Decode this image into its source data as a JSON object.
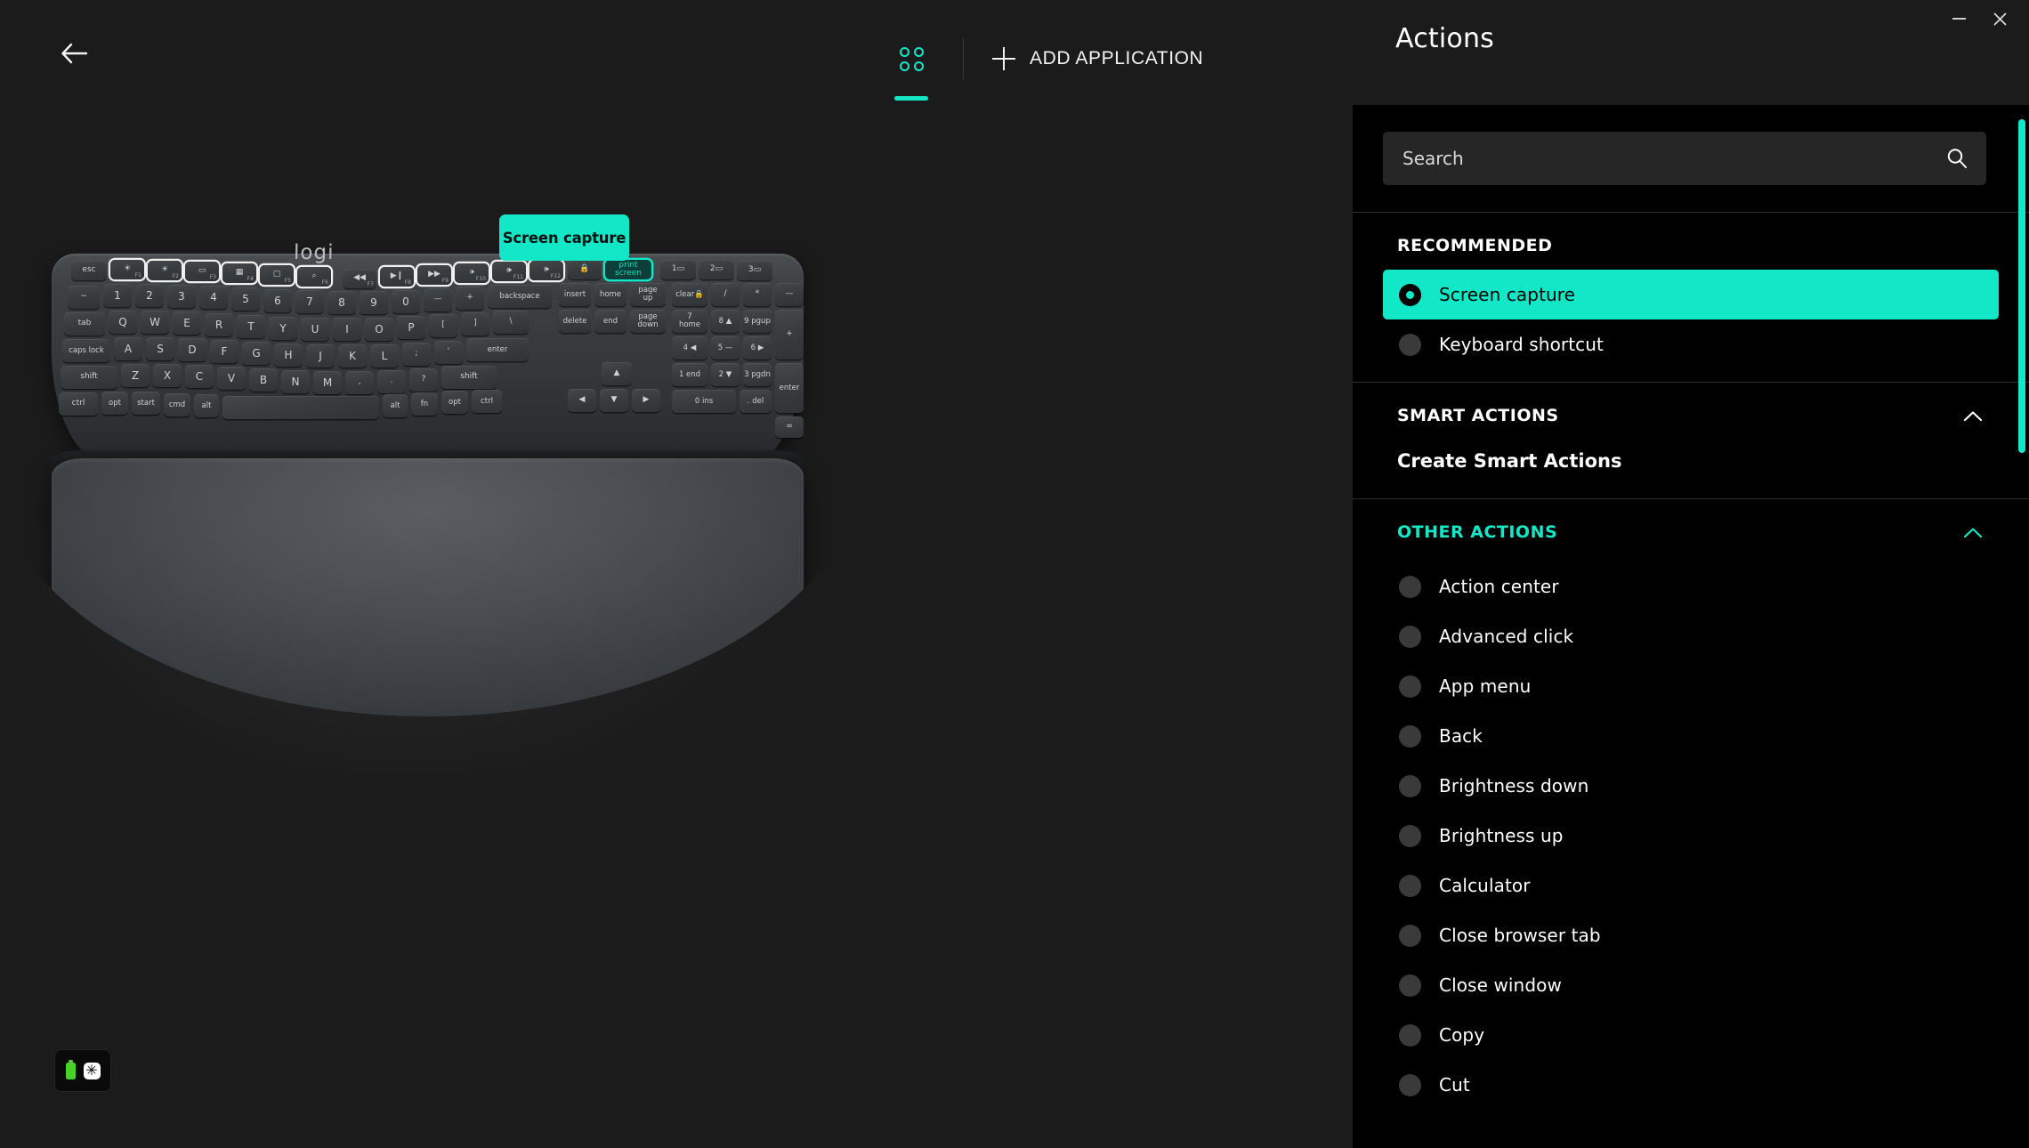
{
  "window": {
    "minimize_label": "—",
    "close_label": "×"
  },
  "toolbar": {
    "back_label": "Back",
    "grid_tab_label": "Applications grid",
    "add_application_label": "ADD APPLICATION"
  },
  "device": {
    "brand": "logi",
    "tooltip_label": "Screen capture",
    "status": {
      "battery_label": "Battery",
      "backlight_label": "Backlight",
      "backlight_glyph": "✳"
    },
    "function_keys": [
      {
        "label": "esc",
        "sub": "",
        "outlined": false
      },
      {
        "label": "☀",
        "sub": "F1",
        "outlined": true
      },
      {
        "label": "☀",
        "sub": "F2",
        "outlined": true
      },
      {
        "label": "▭",
        "sub": "F3",
        "outlined": true
      },
      {
        "label": "▦",
        "sub": "F4",
        "outlined": true
      },
      {
        "label": "▢",
        "sub": "F5",
        "outlined": true
      },
      {
        "label": "⌕",
        "sub": "F6",
        "outlined": true
      },
      {
        "label": "◀◀",
        "sub": "F7",
        "outlined": false
      },
      {
        "label": "▶❙",
        "sub": "F8",
        "outlined": true
      },
      {
        "label": "▶▶",
        "sub": "F9",
        "outlined": true
      },
      {
        "label": "🕩",
        "sub": "F10",
        "outlined": true
      },
      {
        "label": "🕪",
        "sub": "F11",
        "outlined": true
      },
      {
        "label": "🕪",
        "sub": "F12",
        "outlined": true
      },
      {
        "label": "🔒",
        "sub": "",
        "outlined": false
      },
      {
        "label": "print screen",
        "sub": "",
        "outlined": false,
        "highlighted": true
      },
      {
        "label": "1 ▭",
        "sub": "",
        "outlined": false
      },
      {
        "label": "2 ▭",
        "sub": "",
        "outlined": false
      },
      {
        "label": "3 ▭",
        "sub": "",
        "outlined": false
      },
      {
        "label": "▤",
        "sub": "",
        "outlined": true
      },
      {
        "label": "▬",
        "sub": "",
        "outlined": false
      },
      {
        "label": "▤",
        "sub": "",
        "outlined": true
      },
      {
        "label": "🔒",
        "sub": "",
        "outlined": true
      }
    ],
    "number_row": [
      "~ `",
      "! 1",
      "@ 2",
      "# 3",
      "$ 4",
      "% 5",
      "^ 6",
      "& 7",
      "* 8",
      "( 9",
      ") 0",
      "_ -",
      "+ =",
      "backspace",
      "insert",
      "home",
      "page up",
      "clear 🔒",
      "/",
      "*",
      "—"
    ],
    "row_q": [
      "tab",
      "Q",
      "W",
      "E",
      "R",
      "T",
      "Y",
      "U",
      "I",
      "O",
      "P",
      "{ [",
      "} ]",
      "| \\",
      "delete",
      "end",
      "page down",
      "7 home",
      "8 ▲",
      "9 pg up",
      "+"
    ],
    "row_a": [
      "caps lock",
      "A",
      "S",
      "D",
      "F",
      "G",
      "H",
      "J",
      "K",
      "L",
      ": ;",
      "\" '",
      "enter",
      "4 ◀",
      "5 —",
      "6 ▶"
    ],
    "row_z": [
      "shift",
      "Z",
      "X",
      "C",
      "V",
      "B",
      "N",
      "M",
      "< ,",
      "> .",
      "? /",
      "shift",
      "▲",
      "1 end",
      "2 ▼",
      "3 pg dn",
      "enter"
    ],
    "row_ctrl": [
      "ctrl",
      "opt",
      "start",
      "cmd",
      "alt",
      "",
      "alt",
      "fn",
      "opt",
      "ctrl",
      "◀",
      "▼",
      "▶",
      "0 ins",
      ". del",
      "="
    ]
  },
  "panel": {
    "title": "Actions",
    "search": {
      "placeholder": "Search",
      "value": "",
      "icon": "search-icon"
    },
    "sections": [
      {
        "id": "recommended",
        "title": "RECOMMENDED",
        "collapsible": false,
        "items": [
          {
            "label": "Screen capture",
            "selected": true
          },
          {
            "label": "Keyboard shortcut",
            "selected": false
          }
        ]
      },
      {
        "id": "smart-actions",
        "title": "SMART ACTIONS",
        "collapsible": true,
        "expanded": true,
        "accent": false,
        "link_label": "Create Smart Actions"
      },
      {
        "id": "other-actions",
        "title": "OTHER ACTIONS",
        "collapsible": true,
        "expanded": true,
        "accent": true,
        "items": [
          {
            "label": "Action center",
            "selected": false
          },
          {
            "label": "Advanced click",
            "selected": false
          },
          {
            "label": "App menu",
            "selected": false
          },
          {
            "label": "Back",
            "selected": false
          },
          {
            "label": "Brightness down",
            "selected": false
          },
          {
            "label": "Brightness up",
            "selected": false
          },
          {
            "label": "Calculator",
            "selected": false
          },
          {
            "label": "Close browser tab",
            "selected": false
          },
          {
            "label": "Close window",
            "selected": false
          },
          {
            "label": "Copy",
            "selected": false
          },
          {
            "label": "Cut",
            "selected": false
          }
        ]
      }
    ]
  },
  "colors": {
    "accent": "#12e8c8",
    "panel_bg": "#000000",
    "app_bg": "#1b1b1b",
    "text": "#ffffff",
    "battery_green": "#4ad22a"
  }
}
